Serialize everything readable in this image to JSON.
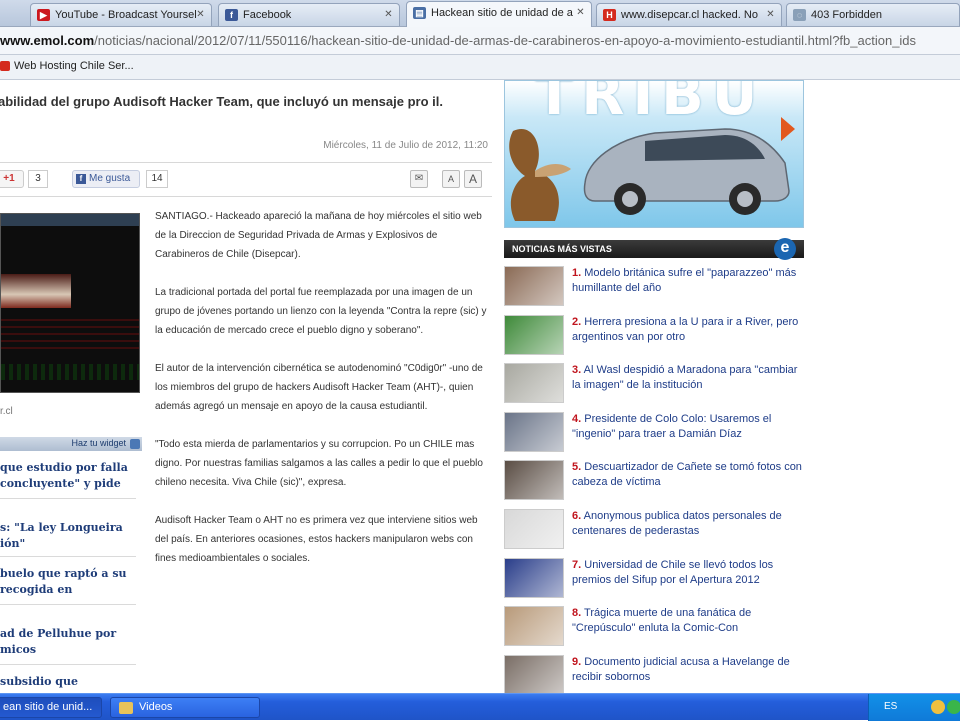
{
  "browser": {
    "tabs": [
      {
        "label": "YouTube - Broadcast Yoursel",
        "icon": "youtube-icon",
        "color": "#cc181e",
        "glyph": "▶"
      },
      {
        "label": "Facebook",
        "icon": "facebook-icon",
        "color": "#3b5998",
        "glyph": "f"
      },
      {
        "label": "Hackean sitio de unidad de a",
        "icon": "document-icon",
        "color": "#4a6fa5",
        "glyph": "▤"
      },
      {
        "label": "www.disepcar.cl hacked. No",
        "icon": "h-site-icon",
        "color": "#d42a1e",
        "glyph": "H"
      },
      {
        "label": "403 Forbidden",
        "icon": "globe-icon",
        "color": "#8aa0b8",
        "glyph": "◌"
      }
    ],
    "url_domain": "www.emol.com",
    "url_path": "/noticias/nacional/2012/07/11/550116/hackean-sitio-de-unidad-de-armas-de-carabineros-en-apoyo-a-movimiento-estudiantil.html?fb_action_ids",
    "bookmark": "Web Hosting Chile Ser..."
  },
  "article": {
    "headline": "abilidad del grupo Audisoft Hacker Team, que incluyó un mensaje pro il.",
    "date": "Miércoles, 11 de Julio de 2012, 11:20",
    "social": {
      "gplus_label": "+1",
      "gplus_count": "3",
      "like_label": "Me gusta",
      "like_count": "14",
      "email_icon": "envelope-icon",
      "text_small": "A",
      "text_large": "A"
    },
    "photo_credit": "r.cl",
    "paragraphs": [
      "SANTIAGO.- Hackeado apareció la mañana de hoy miércoles el sitio web de la Direccion de Seguridad Privada de Armas y Explosivos de Carabineros de Chile (Disepcar).",
      "La tradicional portada del portal fue reemplazada por una imagen de un grupo de jóvenes portando un lienzo con la leyenda \"Contra la repre (sic) y la educación de mercado crece el pueblo digno y soberano\".",
      "El autor de la intervención cibernética se autodenominó \"C0dig0r\" -uno de los miembros del grupo de hackers Audisoft Hacker Team (AHT)-, quien además agregó un mensaje en apoyo de la causa estudiantil.",
      "\"Todo esta mierda de parlamentarios y su corrupcion. Po un CHILE mas digno. Por nuestras familias salgamos a las calles a pedir lo que el pueblo chileno necesita. Viva Chile (sic)\", expresa.",
      "Audisoft Hacker Team o AHT no es primera vez que interviene sitios web del país. En anteriores ocasiones, estos hackers manipularon webs con fines medioambientales o sociales."
    ]
  },
  "widget": {
    "label": "Haz tu widget",
    "items": [
      "que estudio por falla concluyente\" y pide",
      "s: \"La ley Longueira ión\"",
      "buelo que raptó a su recogida en",
      "ad de Pelluhue por micos",
      "subsidio que"
    ]
  },
  "ad": {
    "brand": "TRIBU"
  },
  "most_viewed": {
    "title": "NOTICIAS MÁS VISTAS",
    "logo": "e",
    "items": [
      {
        "num": "1.",
        "text": "Modelo británica sufre el \"paparazzeo\" más humillante del año",
        "thumb": "#8a6a55"
      },
      {
        "num": "2.",
        "text": "Herrera presiona a la U para ir a River, pero argentinos van por otro",
        "thumb": "#3f8a3a"
      },
      {
        "num": "3.",
        "text": "Al Wasl despidió a Maradona para \"cambiar la imagen\" de la institución",
        "thumb": "#a8a8a0"
      },
      {
        "num": "4.",
        "text": "Presidente de Colo Colo: Usaremos el \"ingenio\" para traer a Damián Díaz",
        "thumb": "#6a7488"
      },
      {
        "num": "5.",
        "text": "Descuartizador de Cañete se tomó fotos con cabeza de víctima",
        "thumb": "#5a4d44"
      },
      {
        "num": "6.",
        "text": "Anonymous publica datos personales de centenares de pederastas",
        "thumb": "#d8d8d8"
      },
      {
        "num": "7.",
        "text": "Universidad de Chile se llevó todos los premios del Sifup por el Apertura 2012",
        "thumb": "#2a3e8a"
      },
      {
        "num": "8.",
        "text": "Trágica muerte de una fanática de \"Crepúsculo\" enluta la Comic-Con",
        "thumb": "#b89a7a"
      },
      {
        "num": "9.",
        "text": "Documento judicial acusa a Havelange de recibir sobornos",
        "thumb": "#7a6e66"
      }
    ]
  },
  "taskbar": {
    "tasks": [
      "ean sitio de unid...",
      "Videos"
    ],
    "language": "ES"
  }
}
